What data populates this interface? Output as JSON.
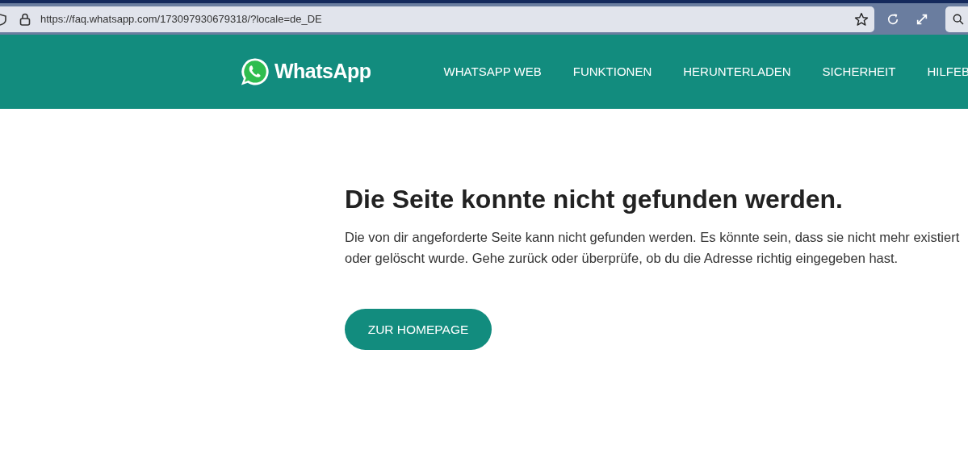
{
  "browser": {
    "url": "https://faq.whatsapp.com/173097930679318/?locale=de_DE"
  },
  "header": {
    "logo": "WhatsApp",
    "nav": [
      "WHATSAPP WEB",
      "FUNKTIONEN",
      "HERUNTERLADEN",
      "SICHERHEIT",
      "HILFEB"
    ]
  },
  "content": {
    "title": "Die Seite konnte nicht gefunden werden.",
    "message": "Die von dir angeforderte Seite kann nicht gefunden werden. Es könnte sein, dass sie nicht mehr existiert oder gelöscht wurde. Gehe zurück oder überprüfe, ob du die Adresse richtig eingegeben hast.",
    "button": "ZUR HOMEPAGE"
  }
}
